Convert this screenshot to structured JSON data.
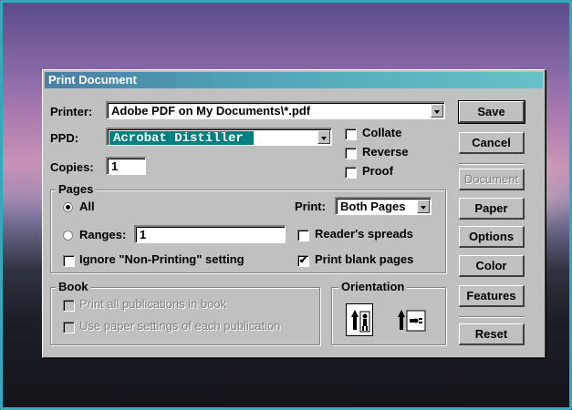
{
  "window": {
    "title": "Print Document"
  },
  "printer": {
    "label": "Printer:",
    "value": "Adobe PDF on My Documents\\*.pdf"
  },
  "ppd": {
    "label": "PPD:",
    "value": "Acrobat Distiller"
  },
  "copies": {
    "label": "Copies:",
    "value": "1"
  },
  "options": {
    "collate": {
      "label": "Collate",
      "checked": false
    },
    "reverse": {
      "label": "Reverse",
      "checked": false
    },
    "proof": {
      "label": "Proof",
      "checked": false
    }
  },
  "pages": {
    "title": "Pages",
    "all_label": "All",
    "ranges_label": "Ranges:",
    "ranges_value": "1",
    "print_label": "Print:",
    "print_value": "Both Pages",
    "readers_spreads_label": "Reader's spreads",
    "ignore_label": "Ignore \"Non-Printing\" setting",
    "blank_pages_label": "Print blank pages",
    "blank_pages_check": "✔"
  },
  "book": {
    "title": "Book",
    "print_all_label": "Print all publications in book",
    "use_paper_label": "Use paper settings of each publication"
  },
  "orientation": {
    "title": "Orientation"
  },
  "buttons": {
    "save": "Save",
    "cancel": "Cancel",
    "document": "Document",
    "paper": "Paper",
    "options": "Options",
    "color": "Color",
    "features": "Features",
    "reset": "Reset"
  }
}
